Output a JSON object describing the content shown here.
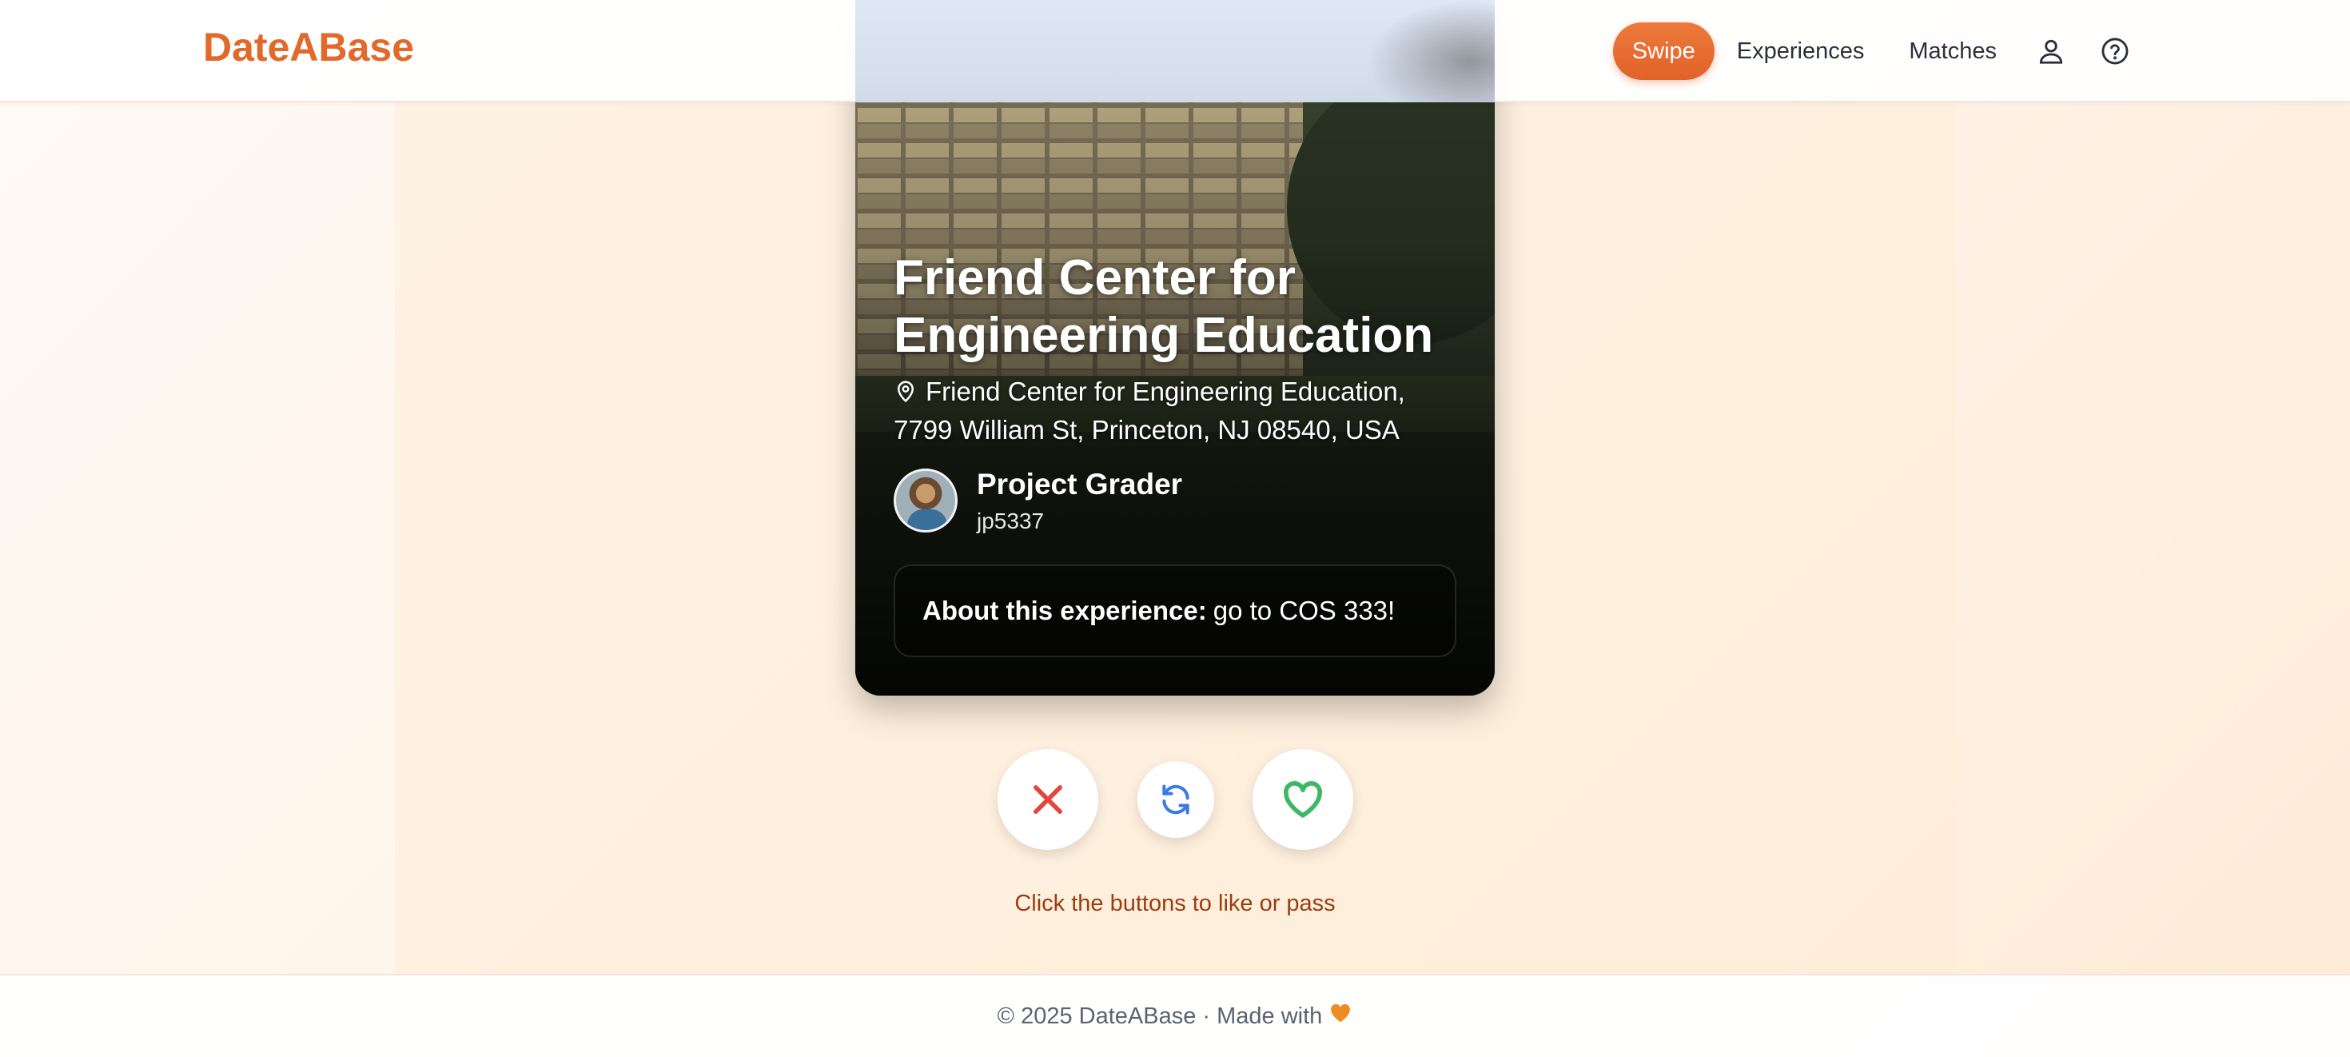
{
  "header": {
    "brand": "DateABase",
    "nav": {
      "swipe": "Swipe",
      "experiences": "Experiences",
      "matches": "Matches"
    },
    "icons": [
      "user-icon",
      "help-circle-icon"
    ]
  },
  "card": {
    "title": "Friend Center for Engineering Education",
    "address": "Friend Center for Engineering Education, 7799 William St, Princeton, NJ 08540, USA",
    "author": {
      "name": "Project Grader",
      "handle": "jp5337"
    },
    "about_label": "About this experience:",
    "about_text": "go to COS 333!"
  },
  "actions": {
    "pass_icon": "x-icon",
    "undo_icon": "refresh-icon",
    "like_icon": "heart-icon"
  },
  "hint": "Click the buttons to like or pass",
  "footer": {
    "text": "© 2025 DateABase · Made with"
  },
  "colors": {
    "brand": "#e2692a",
    "pass": "#e0483f",
    "undo": "#3b7be0",
    "like": "#3fb866"
  }
}
